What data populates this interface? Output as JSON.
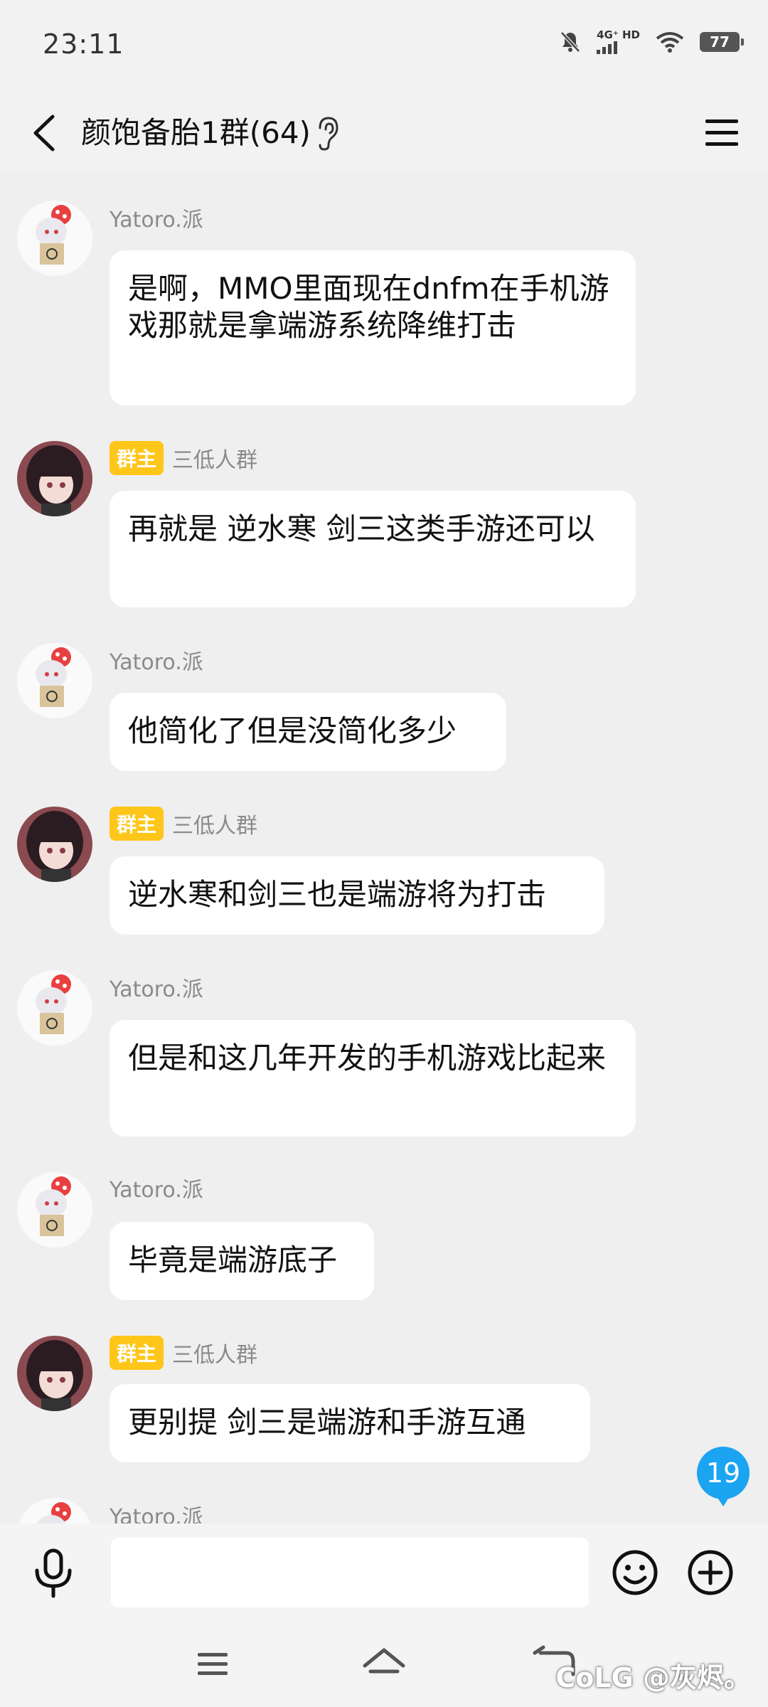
{
  "status": {
    "time": "23:11",
    "network": "4G⁺ HD",
    "battery": "77"
  },
  "header": {
    "title": "颜饱备胎1群(64)"
  },
  "messages": [
    {
      "sender": "Yatoro.派",
      "badge": "",
      "text": "是啊，MMO里面现在dnfm在手机游戏那就是拿端游系统降维打击"
    },
    {
      "sender": "三低人群",
      "badge": "群主",
      "text": "再就是 逆水寒 剑三这类手游还可以"
    },
    {
      "sender": "Yatoro.派",
      "badge": "",
      "text": "他简化了但是没简化多少"
    },
    {
      "sender": "三低人群",
      "badge": "群主",
      "text": "逆水寒和剑三也是端游将为打击"
    },
    {
      "sender": "Yatoro.派",
      "badge": "",
      "text": "但是和这几年开发的手机游戏比起来"
    },
    {
      "sender": "Yatoro.派",
      "badge": "",
      "text": "毕竟是端游底子"
    },
    {
      "sender": "三低人群",
      "badge": "群主",
      "text": "更别提  剑三是端游和手游互通"
    },
    {
      "sender": "Yatoro.派",
      "badge": "",
      "text": ""
    }
  ],
  "unread_count": "19",
  "input": {
    "placeholder": ""
  },
  "watermark": "CoLG @灰烬。",
  "icons": {
    "back": "back-arrow-icon",
    "ear": "ear-icon",
    "menu": "hamburger-menu-icon",
    "mic": "microphone-icon",
    "emoji": "emoji-icon",
    "plus": "plus-icon",
    "nav_menu": "nav-menu-icon",
    "nav_home": "nav-home-icon",
    "nav_back": "nav-back-icon"
  }
}
